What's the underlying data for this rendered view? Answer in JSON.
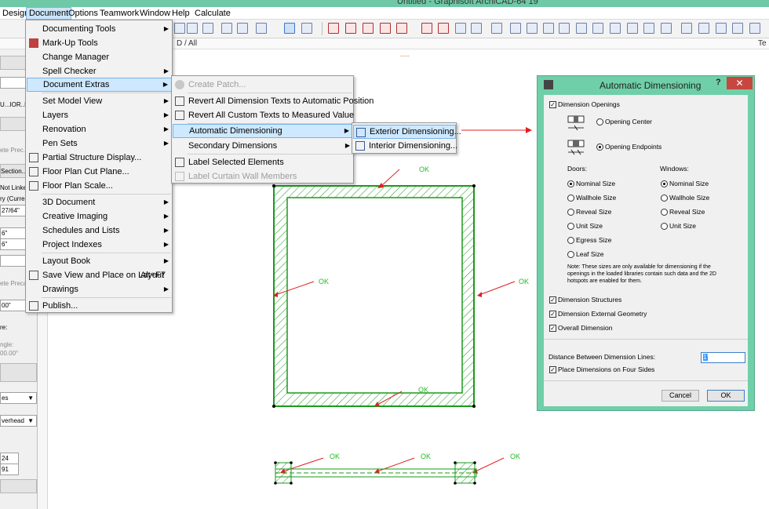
{
  "window": {
    "title": "Untitled - Graphisoft ArchiCAD-64 19"
  },
  "menubar": [
    "Design",
    "Document",
    "Options",
    "Teamwork",
    "Window",
    "Help",
    "Calculate"
  ],
  "tabs": {
    "left": "D / All",
    "right": "Te"
  },
  "infobox": {
    "lines": [
      "U...IOR..M",
      "ete Prec...",
      "Section...",
      "Not Linke",
      "ry (Curren",
      "27/64\"",
      "6\"",
      "6\"",
      "ete Precast",
      "00\"",
      "re:",
      "ngle:",
      "00.00°",
      "es",
      "verhead",
      "24",
      "91"
    ]
  },
  "document_menu": {
    "items": [
      {
        "label": "Documenting Tools",
        "submenu": true
      },
      {
        "label": "Mark-Up Tools"
      },
      {
        "label": "Change Manager"
      },
      {
        "label": "Spell Checker",
        "submenu": true
      },
      {
        "label": "Document Extras",
        "submenu": true,
        "highlighted": true
      },
      {
        "label": "Set Model View",
        "submenu": true
      },
      {
        "label": "Layers",
        "submenu": true
      },
      {
        "label": "Renovation",
        "submenu": true
      },
      {
        "label": "Pen Sets",
        "submenu": true
      },
      {
        "label": "Partial Structure Display..."
      },
      {
        "label": "Floor Plan Cut Plane..."
      },
      {
        "label": "Floor Plan Scale..."
      },
      {
        "label": "3D Document",
        "submenu": true
      },
      {
        "label": "Creative Imaging",
        "submenu": true
      },
      {
        "label": "Schedules and Lists",
        "submenu": true
      },
      {
        "label": "Project Indexes",
        "submenu": true
      },
      {
        "label": "Layout Book",
        "submenu": true
      },
      {
        "label": "Save View and Place on Layout",
        "shortcut": "Alt+F7"
      },
      {
        "label": "Drawings",
        "submenu": true
      },
      {
        "label": "Publish..."
      }
    ]
  },
  "extras_menu": {
    "items": [
      {
        "label": "Create Patch...",
        "disabled": true
      },
      {
        "label": "Revert All Dimension Texts to Automatic Position"
      },
      {
        "label": "Revert All Custom Texts to Measured Value"
      },
      {
        "label": "Automatic Dimensioning",
        "submenu": true,
        "highlighted": true
      },
      {
        "label": "Secondary Dimensions",
        "submenu": true
      },
      {
        "label": "Label Selected Elements"
      },
      {
        "label": "Label Curtain Wall Members",
        "disabled": true
      }
    ]
  },
  "auto_dim_menu": {
    "items": [
      {
        "label": "Exterior Dimensioning...",
        "highlighted": true
      },
      {
        "label": "Interior Dimensioning..."
      }
    ]
  },
  "dialog": {
    "title": "Automatic Dimensioning",
    "help": "?",
    "close": "✕",
    "dimension_openings": "Dimension Openings",
    "opening_center": "Opening Center",
    "opening_endpoints": "Opening Endpoints",
    "doors_label": "Doors:",
    "windows_label": "Windows:",
    "doors": [
      "Nominal Size",
      "Wallhole Size",
      "Reveal Size",
      "Unit Size",
      "Egress Size",
      "Leaf Size"
    ],
    "windows": [
      "Nominal Size",
      "Wallhole Size",
      "Reveal Size",
      "Unit Size"
    ],
    "note": [
      "Note: These sizes are only available for dimensioning if the",
      "openings in the loaded libraries contain such data and the 2D",
      "hotspots are enabled for them."
    ],
    "dimension_structures": "Dimension Structures",
    "dimension_external_geometry": "Dimension External Geometry",
    "overall_dimension": "Overall Dimension",
    "distance_label": "Distance Between Dimension Lines:",
    "distance_value": "1'",
    "place_four_sides": "Place Dimensions on Four Sides",
    "cancel": "Cancel",
    "ok": "OK"
  },
  "canvas": {
    "ok_label": "OK",
    "dashes": "----"
  },
  "colors": {
    "accent": "#6fcfa8",
    "wall": "#1a9a1a",
    "annotation": "#e02020",
    "ok_text": "#22bb22"
  }
}
